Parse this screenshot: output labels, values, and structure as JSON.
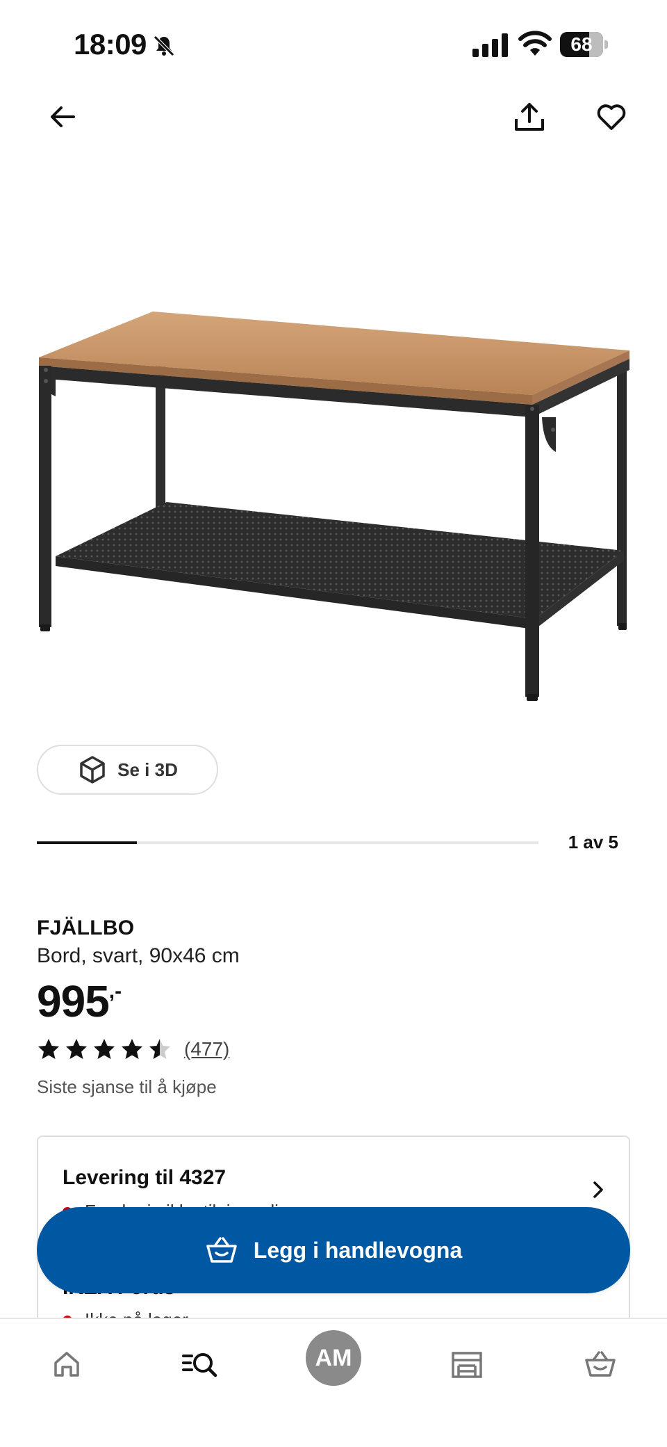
{
  "status_bar": {
    "time": "18:09",
    "battery": "68",
    "battery_level": 0.68
  },
  "header": {
    "icons": [
      "back-arrow-icon",
      "share-icon",
      "heart-icon"
    ]
  },
  "gallery": {
    "view_3d_label": "Se i 3D",
    "counter": "1 av 5",
    "current": 1,
    "total": 5
  },
  "product": {
    "name": "FJÄLLBO",
    "description": "Bord, svart, 90x46 cm",
    "price": "995",
    "price_suffix": ",-",
    "rating": 4.5,
    "review_count": "(477)",
    "availability_note": "Siste sjanse til å kjøpe"
  },
  "delivery": {
    "title": "Levering til 4327",
    "status": "Foreløpig ikke tilgjengelig",
    "store_title": "IKEA Forus",
    "store_status": "Ikke på lager"
  },
  "cart_button": {
    "label": "Legg i handlevogna"
  },
  "bottom_nav": {
    "profile_initials": "AM"
  },
  "colors": {
    "primary_blue": "#0058a3",
    "status_red": "#cc0008"
  }
}
